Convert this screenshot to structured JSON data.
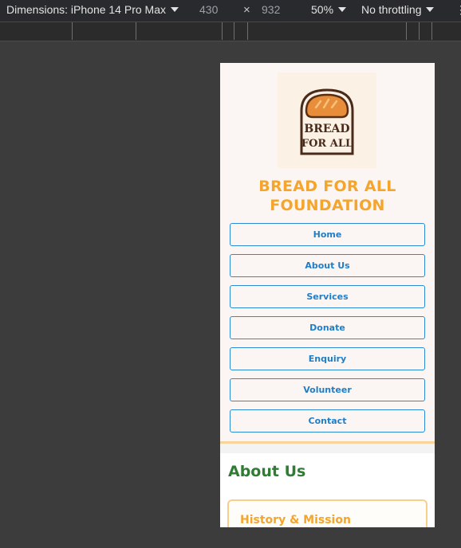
{
  "devtools": {
    "dimensions_label": "Dimensions: iPhone 14 Pro Max",
    "width_value": "430",
    "times_symbol": "×",
    "height_value": "932",
    "zoom_value": "50%",
    "throttle_value": "No throttling",
    "more_glyph": "⋮"
  },
  "site": {
    "logo_text_line1": "BREAD",
    "logo_text_line2": "FOR ALL",
    "title_line1": "BREAD FOR ALL",
    "title_line2": "FOUNDATION",
    "nav": [
      {
        "label": "Home"
      },
      {
        "label": "About Us"
      },
      {
        "label": "Services"
      },
      {
        "label": "Donate"
      },
      {
        "label": "Enquiry"
      },
      {
        "label": "Volunteer"
      },
      {
        "label": "Contact"
      }
    ]
  },
  "main": {
    "section_title": "About Us",
    "card_title": "History & Mission"
  },
  "colors": {
    "accent_orange": "#f5a42c",
    "nav_blue": "#1f7ec8",
    "heading_green": "#2e7d32"
  }
}
